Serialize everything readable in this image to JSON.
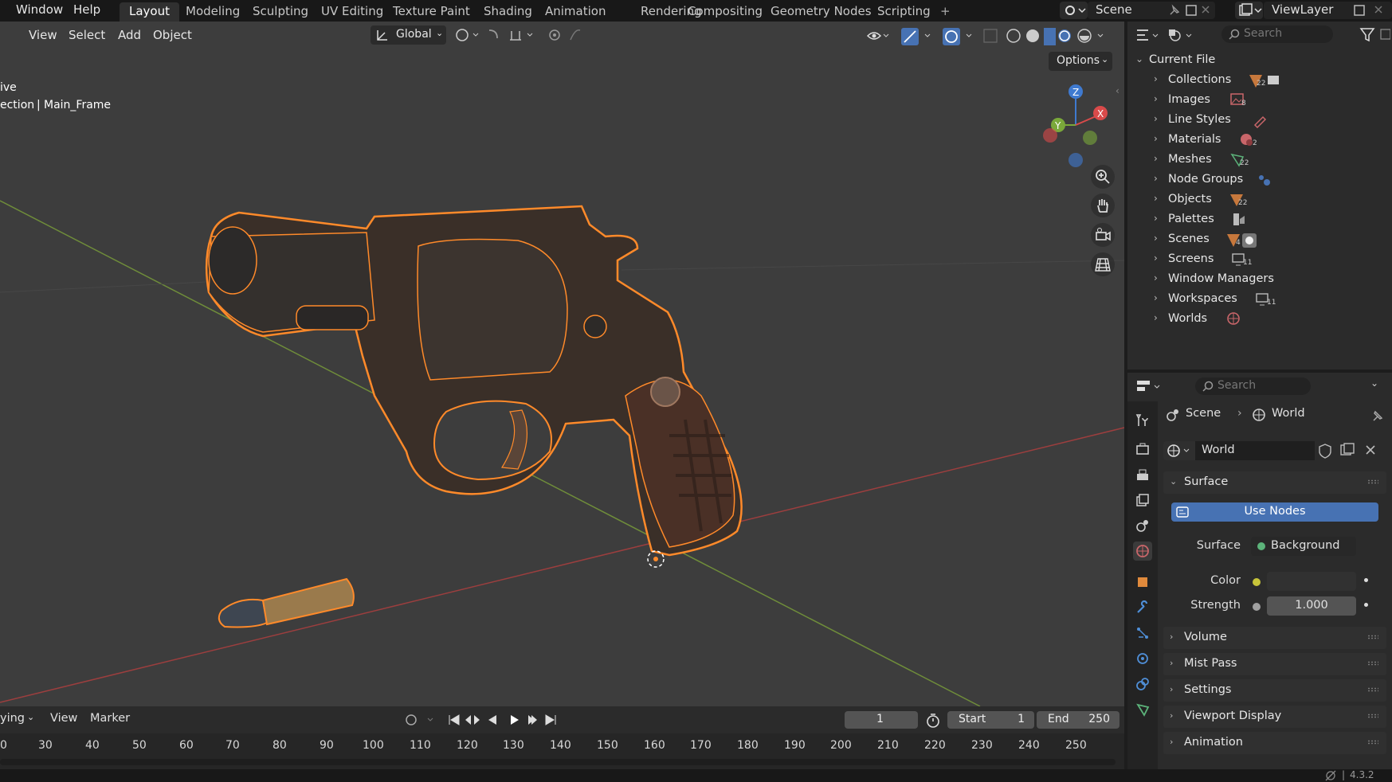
{
  "topbar": {
    "menus": [
      "Window",
      "Help"
    ],
    "workspaces": [
      "Layout",
      "Modeling",
      "Sculpting",
      "UV Editing",
      "Texture Paint",
      "Shading",
      "Animation",
      "Rendering",
      "Compositing",
      "Geometry Nodes",
      "Scripting"
    ],
    "add_tab": "+",
    "scene": "Scene",
    "view_layer": "ViewLayer"
  },
  "viewport": {
    "menus": [
      "View",
      "Select",
      "Add",
      "Object"
    ],
    "orientation": "Global",
    "options": "Options",
    "overlay_mode": "ive",
    "overlay_path_prefix": "ection",
    "overlay_path_object": "Main_Frame",
    "gizmo": {
      "z": "Z",
      "y": "Y",
      "x": "X"
    }
  },
  "timeline": {
    "playback": "ying",
    "menus": [
      "View",
      "Marker"
    ],
    "current_frame": "1",
    "start_label": "Start",
    "start_value": "1",
    "end_label": "End",
    "end_value": "250",
    "ticks": [
      "0",
      "30",
      "40",
      "50",
      "60",
      "70",
      "80",
      "90",
      "100",
      "110",
      "120",
      "130",
      "140",
      "150",
      "160",
      "170",
      "180",
      "190",
      "200",
      "210",
      "220",
      "230",
      "240",
      "250"
    ]
  },
  "outliner": {
    "search_placeholder": "Search",
    "root": "Current File",
    "items": [
      {
        "label": "Collections",
        "count": "22"
      },
      {
        "label": "Images",
        "count": "8"
      },
      {
        "label": "Line Styles",
        "count": ""
      },
      {
        "label": "Materials",
        "count": "2"
      },
      {
        "label": "Meshes",
        "count": "22"
      },
      {
        "label": "Node Groups",
        "count": ""
      },
      {
        "label": "Objects",
        "count": "22"
      },
      {
        "label": "Palettes",
        "count": ""
      },
      {
        "label": "Scenes",
        "count": "4"
      },
      {
        "label": "Screens",
        "count": "11"
      },
      {
        "label": "Window Managers",
        "count": ""
      },
      {
        "label": "Workspaces",
        "count": "11"
      },
      {
        "label": "Worlds",
        "count": ""
      }
    ]
  },
  "properties": {
    "search_placeholder": "Search",
    "breadcrumb_scene": "Scene",
    "breadcrumb_world": "World",
    "world_name": "World",
    "panels": {
      "surface": "Surface",
      "use_nodes": "Use Nodes",
      "surface_label": "Surface",
      "surface_value": "Background",
      "color_label": "Color",
      "strength_label": "Strength",
      "strength_value": "1.000",
      "volume": "Volume",
      "mist_pass": "Mist Pass",
      "settings": "Settings",
      "viewport_display": "Viewport Display",
      "animation": "Animation"
    }
  },
  "status": {
    "version": "4.3.2"
  },
  "colors": {
    "accent": "#4772b3",
    "selection_outline": "#ff8a2a",
    "x_axis": "#d94a4a",
    "y_axis": "#7aa83a",
    "z_axis": "#3f7ad0"
  }
}
